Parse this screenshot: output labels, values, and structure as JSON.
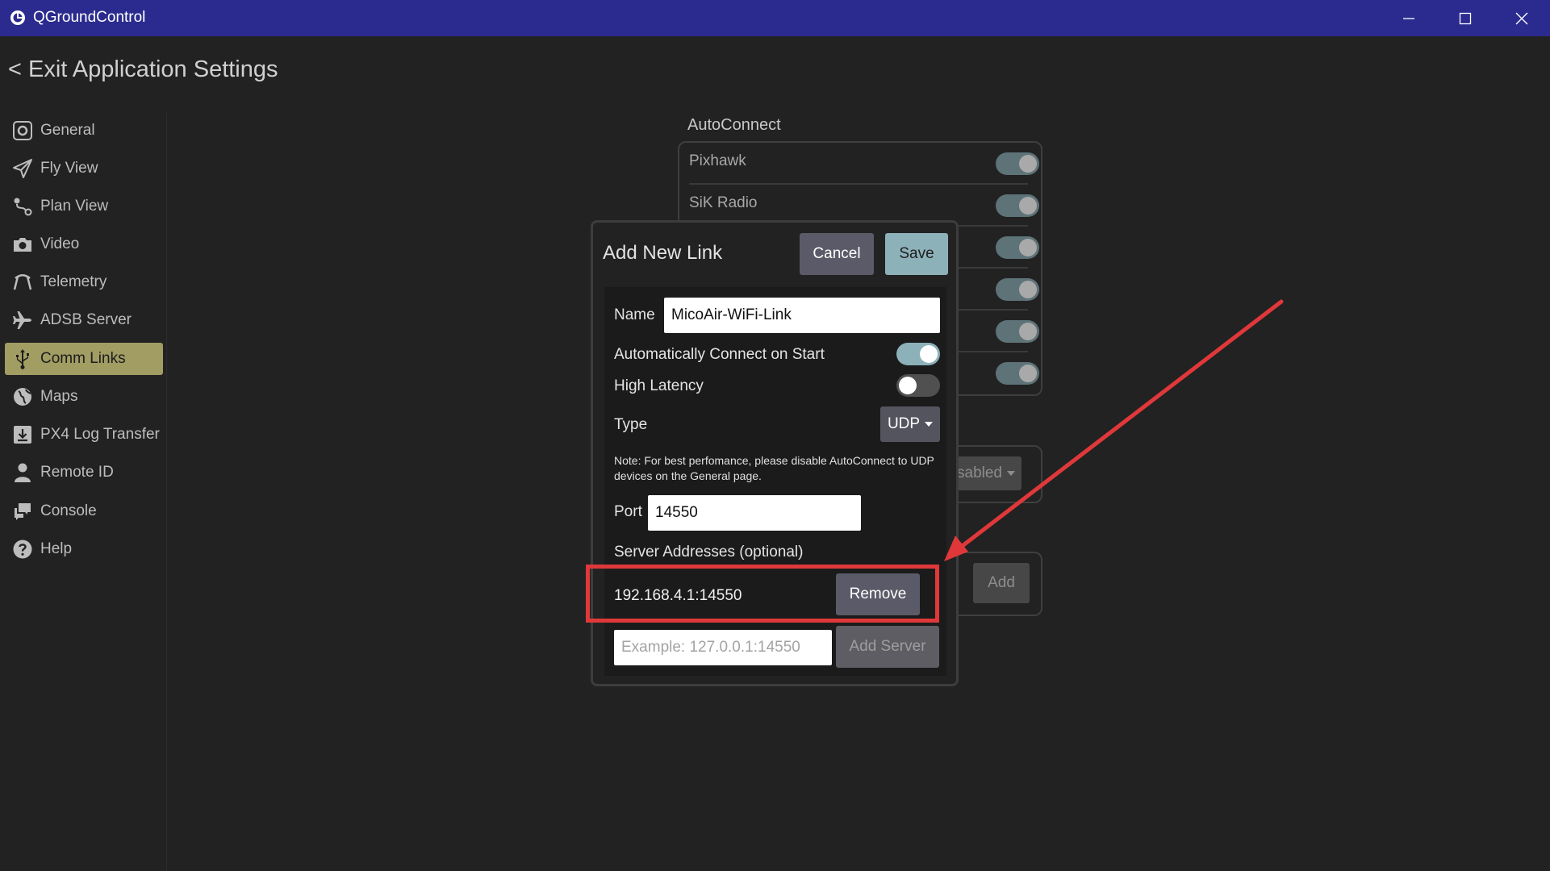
{
  "window": {
    "title": "QGroundControl",
    "titlebar_color": "#2b2b8f"
  },
  "header": {
    "exit_label": "< Exit Application Settings"
  },
  "sidebar": {
    "items": [
      {
        "label": "General",
        "icon": "gear-icon"
      },
      {
        "label": "Fly View",
        "icon": "paper-plane-icon"
      },
      {
        "label": "Plan View",
        "icon": "route-icon"
      },
      {
        "label": "Video",
        "icon": "camera-icon"
      },
      {
        "label": "Telemetry",
        "icon": "telemetry-icon"
      },
      {
        "label": "ADSB Server",
        "icon": "airplane-icon"
      },
      {
        "label": "Comm Links",
        "icon": "usb-icon",
        "active": true
      },
      {
        "label": "Maps",
        "icon": "globe-icon"
      },
      {
        "label": "PX4 Log Transfer",
        "icon": "download-icon"
      },
      {
        "label": "Remote ID",
        "icon": "person-icon"
      },
      {
        "label": "Console",
        "icon": "chat-icon"
      },
      {
        "label": "Help",
        "icon": "help-icon"
      }
    ],
    "active_color": "#a19d63"
  },
  "background": {
    "autoconnect_title": "AutoConnect",
    "autoconnect_items": [
      "Pixhawk",
      "SiK Radio",
      "",
      "",
      "",
      ""
    ],
    "dropdown_value": "isabled",
    "add_label": "Add"
  },
  "dialog": {
    "title": "Add New Link",
    "cancel_label": "Cancel",
    "save_label": "Save",
    "name_label": "Name",
    "name_value": "MicoAir-WiFi-Link",
    "auto_connect_label": "Automatically Connect on Start",
    "auto_connect_on": true,
    "high_latency_label": "High Latency",
    "high_latency_on": false,
    "type_label": "Type",
    "type_value": "UDP",
    "note": "Note: For best perfomance, please disable AutoConnect to UDP devices on the General page.",
    "port_label": "Port",
    "port_value": "14550",
    "server_addresses_label": "Server Addresses (optional)",
    "server_address": "192.168.4.1:14550",
    "remove_label": "Remove",
    "server_placeholder": "Example: 127.0.0.1:14550",
    "add_server_label": "Add Server",
    "accent_color": "#8db1b8"
  },
  "annotation": {
    "color": "#e0383a"
  }
}
